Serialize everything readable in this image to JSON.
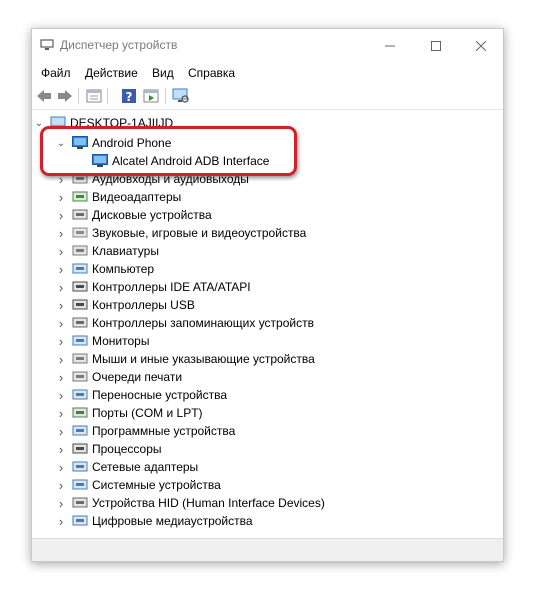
{
  "window": {
    "title": "Диспетчер устройств",
    "controls": [
      "minimize",
      "maximize",
      "close"
    ]
  },
  "menu": [
    "Файл",
    "Действие",
    "Вид",
    "Справка"
  ],
  "toolbar": [
    "back-icon",
    "forward-icon",
    "properties-icon",
    "help-icon",
    "show-hidden-icon",
    "scan-hardware-icon"
  ],
  "tree": {
    "root": "DESKTOP-1AJIIJD",
    "android_group": "Android Phone",
    "android_child": "Alcatel Android ADB Interface",
    "categories": [
      "Аудиовходы и аудиовыходы",
      "Видеоадаптеры",
      "Дисковые устройства",
      "Звуковые, игровые и видеоустройства",
      "Клавиатуры",
      "Компьютер",
      "Контроллеры IDE ATA/ATAPI",
      "Контроллеры USB",
      "Контроллеры запоминающих устройств",
      "Мониторы",
      "Мыши и иные указывающие устройства",
      "Очереди печати",
      "Переносные устройства",
      "Порты (COM и LPT)",
      "Программные устройства",
      "Процессоры",
      "Сетевые адаптеры",
      "Системные устройства",
      "Устройства HID (Human Interface Devices)",
      "Цифровые медиаустройства"
    ]
  },
  "colors": {
    "highlight": "#d0202a",
    "device_icon": "#2a7fd4"
  }
}
